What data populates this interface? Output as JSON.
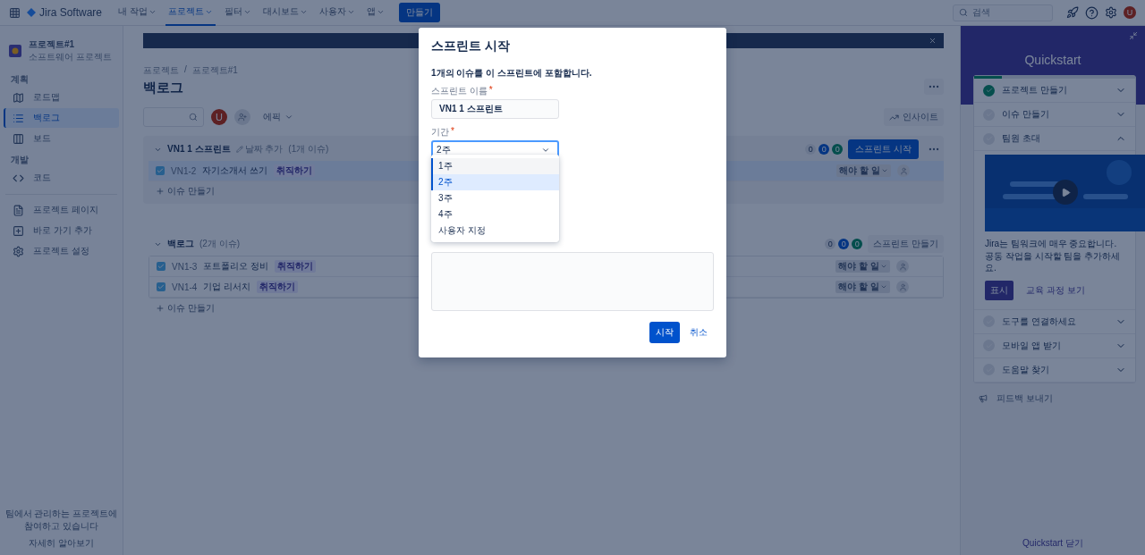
{
  "topbar": {
    "product": "Jira Software",
    "nav": [
      {
        "label": "내 작업",
        "selected": false
      },
      {
        "label": "프로젝트",
        "selected": true
      },
      {
        "label": "필터",
        "selected": false
      },
      {
        "label": "대시보드",
        "selected": false
      },
      {
        "label": "사용자",
        "selected": false
      },
      {
        "label": "앱",
        "selected": false
      }
    ],
    "create": "만들기",
    "search": {
      "placeholder": "검색"
    },
    "avatar": "U"
  },
  "sidebar": {
    "project": {
      "name": "프로젝트#1",
      "type": "소프트웨어 프로젝트"
    },
    "groups": [
      {
        "heading": "계획",
        "items": [
          {
            "label": "로드맵",
            "selected": false
          },
          {
            "label": "백로그",
            "selected": true
          },
          {
            "label": "보드",
            "selected": false
          }
        ]
      },
      {
        "heading": "개발",
        "items": [
          {
            "label": "코드",
            "selected": false
          }
        ]
      },
      {
        "items": [
          {
            "label": "프로젝트 페이지",
            "selected": false
          },
          {
            "label": "바로 가기 추가",
            "selected": false
          },
          {
            "label": "프로젝트 설정",
            "selected": false
          }
        ]
      }
    ],
    "footer": {
      "text": "팀에서 관리하는 프로젝트에 참여하고 있습니다",
      "link": "자세히 알아보기"
    }
  },
  "main": {
    "breadcrumbs": [
      "프로젝트",
      "프로젝트#1"
    ],
    "breadcrumb_separator": "/",
    "title": "백로그",
    "avatar": "U",
    "epic": "에픽",
    "insights": "인사이트",
    "sections": [
      {
        "name": "VN1 1 스프린트",
        "add_dates": "날짜 추가",
        "count": "(1개 이슈)",
        "counts": [
          "0",
          "0",
          "0"
        ],
        "action": {
          "label": "스프린트 시작",
          "primary": true
        },
        "more": true,
        "issues": [
          {
            "key": "VN1-2",
            "summary": "자기소개서 쓰기",
            "epic": "취직하기",
            "status": "해야 할 일",
            "selected": true
          }
        ],
        "create": "이슈 만들기"
      },
      {
        "name": "백로그",
        "count": "(2개 이슈)",
        "counts": [
          "0",
          "0",
          "0"
        ],
        "action": {
          "label": "스프린트 만들기",
          "primary": false
        },
        "more": false,
        "issues": [
          {
            "key": "VN1-3",
            "summary": "포트폴리오 정비",
            "epic": "취직하기",
            "status": "해야 할 일",
            "selected": false
          },
          {
            "key": "VN1-4",
            "summary": "기업 리서치",
            "epic": "취직하기",
            "status": "해야 할 일",
            "selected": false
          }
        ],
        "create": "이슈 만들기"
      }
    ]
  },
  "quickstart": {
    "title": "Quickstart",
    "level": 0.17,
    "items": [
      {
        "label": "프로젝트 만들기",
        "done": true,
        "expanded": false
      },
      {
        "label": "이슈 만들기",
        "done": false,
        "expanded": false
      },
      {
        "label": "팀원 초대",
        "done": false,
        "expanded": true,
        "body": "Jira는 팀워크에 매우 중요합니다. 공동 작업을 시작할 팀을 추가하세요.",
        "actions": [
          "표시",
          "교육 과정 보기"
        ]
      },
      {
        "label": "도구를 연결하세요",
        "done": false,
        "expanded": false
      },
      {
        "label": "모바일 앱 받기",
        "done": false,
        "expanded": false
      },
      {
        "label": "도움말 찾기",
        "done": false,
        "expanded": false
      }
    ],
    "feedback": "피드백 보내기",
    "close": "Quickstart 닫기"
  },
  "modal": {
    "title": "스프린트 시작",
    "intro": "1개의 이슈를 이 스프린트에 포함합니다.",
    "required_mark": "*",
    "name_field": {
      "label": "스프린트 이름",
      "required": true,
      "value": "VN1 1 스프린트"
    },
    "duration": {
      "label": "기간",
      "required": true,
      "value": "2주",
      "open": true,
      "options": [
        {
          "label": "1주",
          "hovered": true,
          "selected": false
        },
        {
          "label": "2주",
          "hovered": false,
          "selected": true
        },
        {
          "label": "3주",
          "hovered": false,
          "selected": false
        },
        {
          "label": "4주",
          "hovered": false,
          "selected": false
        },
        {
          "label": "사용자 지정",
          "hovered": false,
          "selected": false
        }
      ]
    },
    "buttons": [
      {
        "label": "시작",
        "primary": true
      },
      {
        "label": "취소",
        "primary": false
      }
    ]
  }
}
